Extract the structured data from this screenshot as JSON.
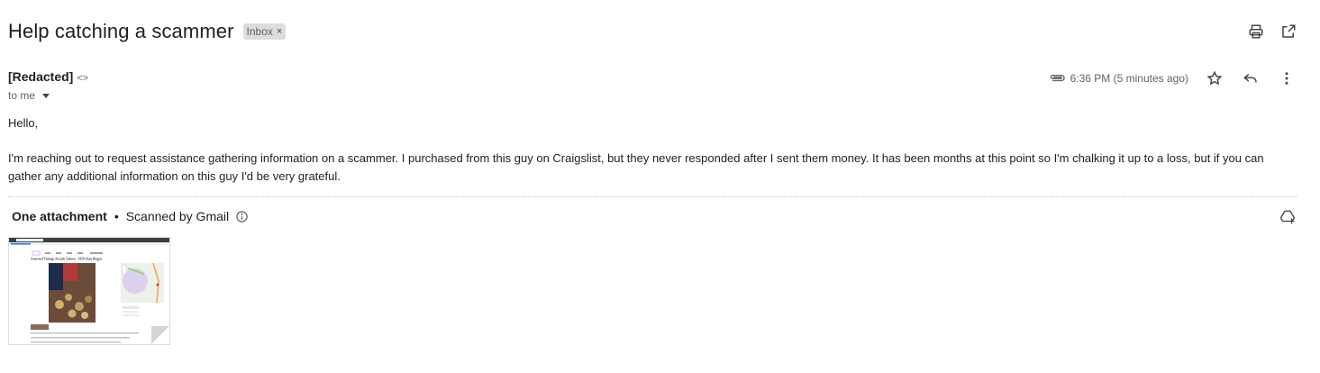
{
  "email": {
    "subject": "Help catching a scammer",
    "label": "Inbox",
    "label_remove": "×",
    "sender_name": "[Redacted]",
    "sender_email": "<>",
    "to_line": "to me",
    "timestamp": "6:36 PM (5 minutes ago)",
    "body": {
      "greeting": "Hello,",
      "paragraph": "I'm reaching out to request assistance gathering information on a scammer. I purchased from this guy on Craigslist, but they never responded after I sent them money. It has been months at this point so I'm chalking it up to a loss, but if you can gather any additional information on this guy I'd be very grateful."
    }
  },
  "attachments": {
    "count_label": "One attachment",
    "separator": "•",
    "scanned_label": "Scanned by Gmail",
    "thumbnail": {
      "page_title": "Assorted Vintage Arcade Tokens - $150 (San Diego)"
    }
  },
  "icons": {
    "print": "print-icon",
    "open_new": "open-in-new-window-icon",
    "attachment": "paperclip-icon",
    "star": "star-icon",
    "reply": "reply-icon",
    "more": "more-vert-icon",
    "info": "info-icon",
    "drive": "add-to-drive-icon"
  }
}
